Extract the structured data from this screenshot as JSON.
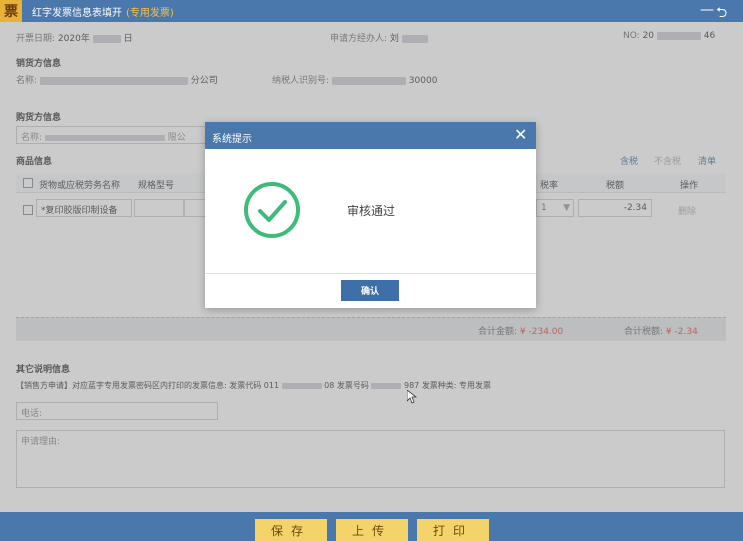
{
  "titlebar": {
    "logo": "票",
    "title": "红字发票信息表填开",
    "subtitle": "(专用发票)",
    "minimize": "—",
    "back": "⮌"
  },
  "header": {
    "date_label": "开票日期:",
    "date_value": "2020年",
    "date_suffix": "日",
    "applicant_label": "申请方经办人:",
    "applicant_value": "刘",
    "no_label": "NO:",
    "no_prefix": "20",
    "no_suffix": "46"
  },
  "seller": {
    "section": "销货方信息",
    "name_label": "名称:",
    "name_suffix": "分公司",
    "tax_label": "纳税人识别号:",
    "tax_suffix": "30000"
  },
  "buyer": {
    "section": "购货方信息",
    "name_label": "名称:",
    "name_suffix": "限公"
  },
  "goods": {
    "section": "商品信息",
    "actions": [
      "含税",
      "不含税",
      "清单"
    ],
    "columns": [
      "货物或应税劳务名称",
      "规格型号",
      "税率",
      "税额",
      "操作"
    ],
    "row": {
      "name": "*复印胶版印制设备",
      "rate": "1",
      "tax": "-2.34",
      "action": "删除"
    },
    "total_amount_label": "合计金额:",
    "total_amount_value": "¥ -234.00",
    "total_tax_label": "合计税额:",
    "total_tax_value": "¥ -2.34"
  },
  "other": {
    "section": "其它说明信息",
    "note_prefix": "【销售方申请】对应蓝字专用发票密码区内打印的发票信息: 发票代码 011",
    "note_code_suffix": "08",
    "note_number_label": "发票号码",
    "note_number_suffix": "987",
    "note_type": "发票种类: 专用发票",
    "phone_placeholder": "电话:",
    "reason_placeholder": "申请理由:"
  },
  "buttons": {
    "save": "保存",
    "upload": "上传",
    "print": "打印"
  },
  "dialog": {
    "title": "系统提示",
    "close": "✕",
    "message": "审核通过",
    "ok": "确认"
  },
  "colors": {
    "titlebar": "#4a78ad",
    "accent_yellow": "#f3d36a",
    "success_green": "#3dbb7a",
    "negative_red": "#e0463c",
    "link_blue": "#3e6fa8"
  }
}
